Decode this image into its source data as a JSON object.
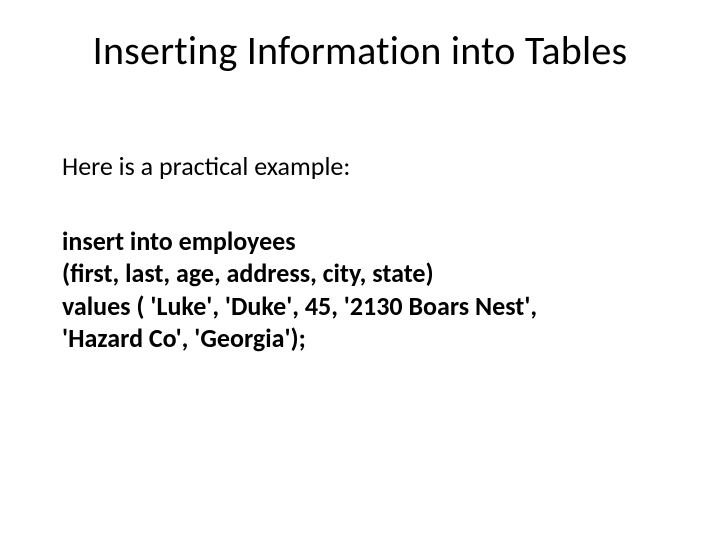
{
  "title": "Inserting Information into Tables",
  "intro": "Here is a practical example:",
  "code": {
    "l1": "insert into employees",
    "l2": "(first, last, age, address, city, state)",
    "l3": "values ( 'Luke', 'Duke', 45, '2130 Boars Nest',",
    "l4": "'Hazard Co', 'Georgia');"
  }
}
